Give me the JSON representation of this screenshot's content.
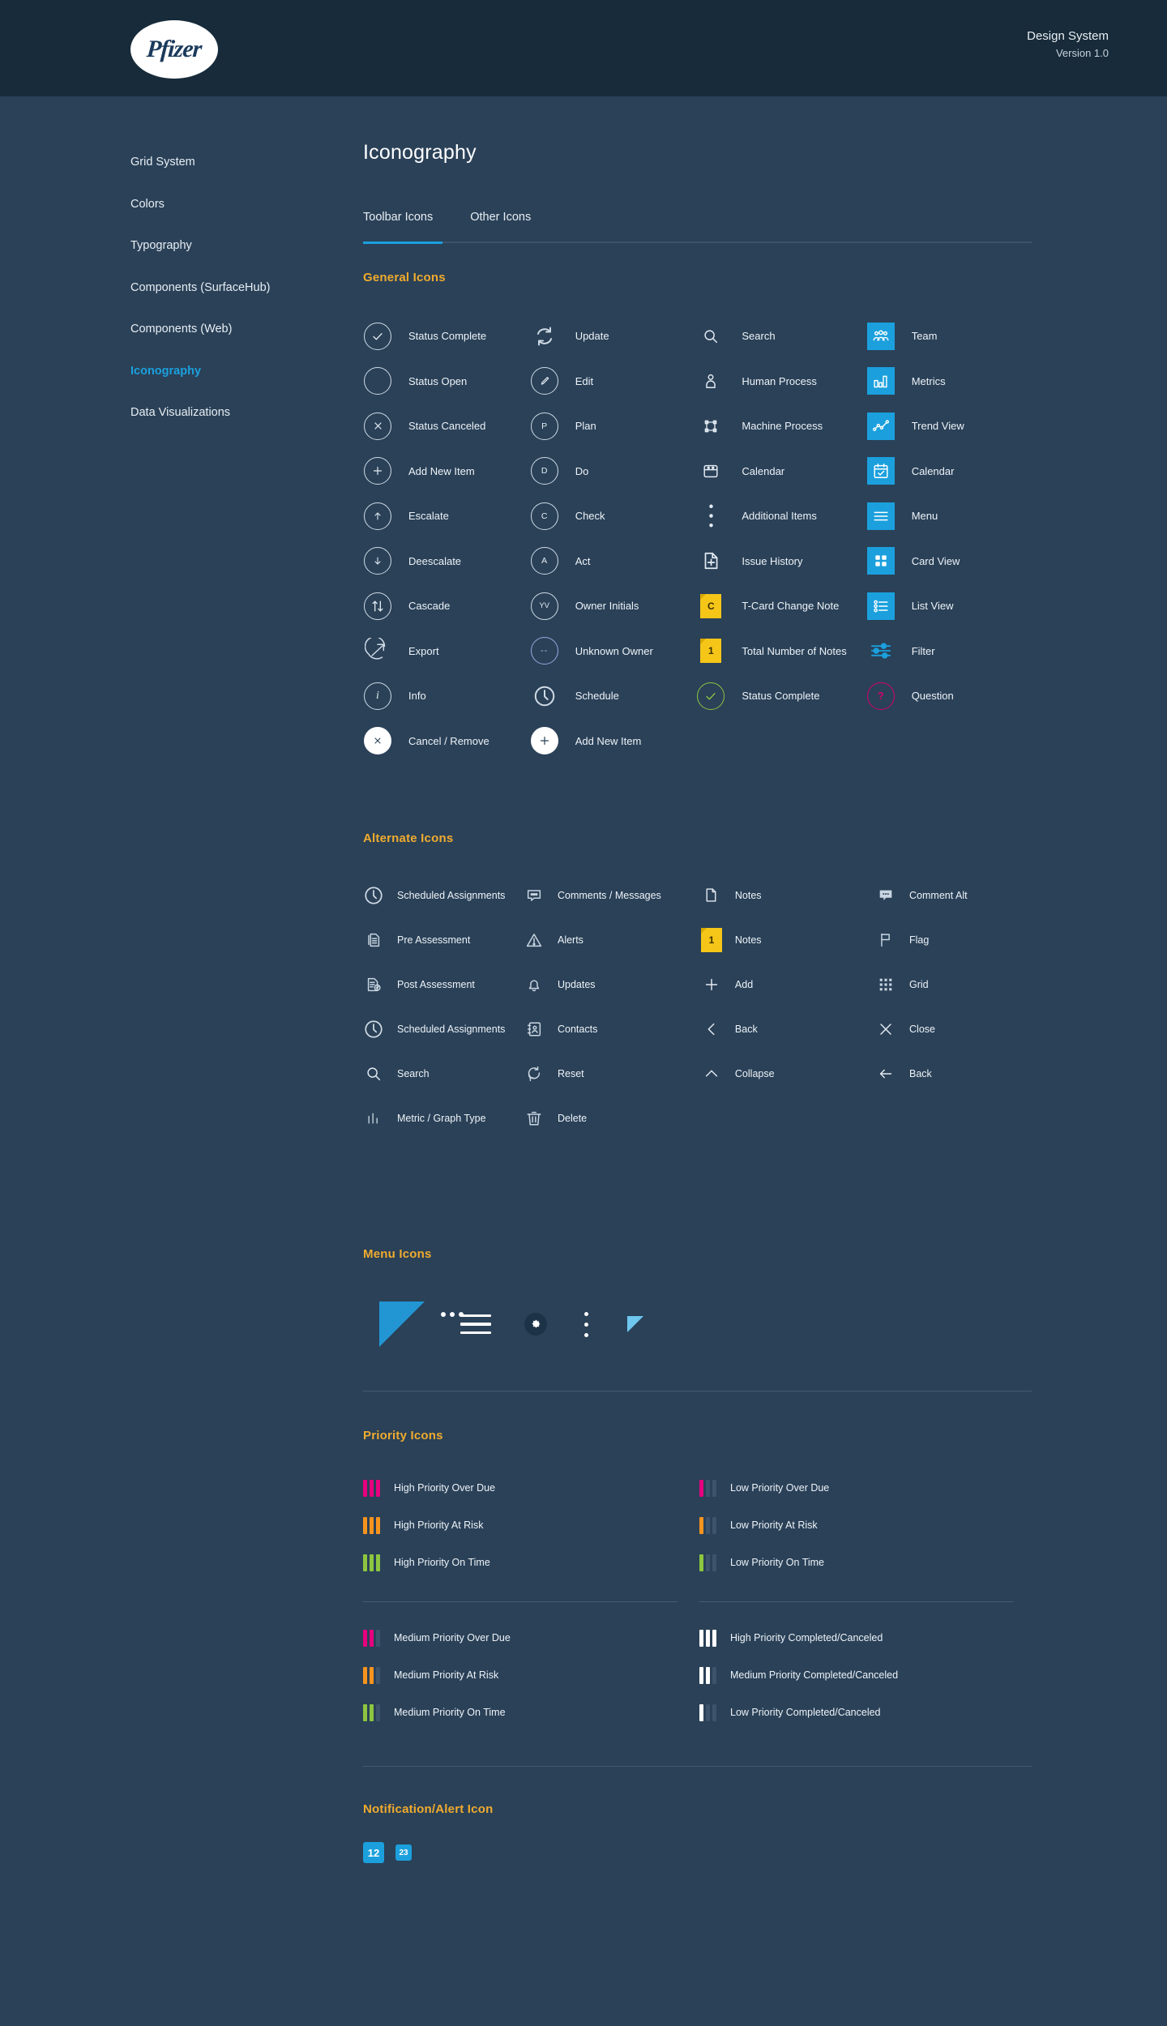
{
  "header": {
    "logo_text": "Pfizer",
    "title": "Design System",
    "version": "Version 1.0"
  },
  "sidebar": {
    "items": [
      {
        "label": "Grid System",
        "active": false
      },
      {
        "label": "Colors",
        "active": false
      },
      {
        "label": "Typography",
        "active": false
      },
      {
        "label": "Components (SurfaceHub)",
        "active": false
      },
      {
        "label": "Components (Web)",
        "active": false
      },
      {
        "label": "Iconography",
        "active": true
      },
      {
        "label": "Data Visualizations",
        "active": false
      }
    ]
  },
  "page": {
    "title": "Iconography",
    "tabs": [
      {
        "label": "Toolbar Icons",
        "active": true
      },
      {
        "label": "Other Icons",
        "active": false
      }
    ]
  },
  "sections": {
    "general": {
      "title": "General Icons",
      "col1": [
        {
          "label": "Status Complete",
          "icon": "circle-check-icon"
        },
        {
          "label": "Status Open",
          "icon": "circle-empty-icon"
        },
        {
          "label": "Status Canceled",
          "icon": "circle-x-icon"
        },
        {
          "label": "Add New Item",
          "icon": "circle-plus-icon"
        },
        {
          "label": "Escalate",
          "icon": "circle-arrow-up-icon"
        },
        {
          "label": "Deescalate",
          "icon": "circle-arrow-down-icon"
        },
        {
          "label": "Cascade",
          "icon": "circle-arrows-updown-icon"
        },
        {
          "label": "Export",
          "icon": "circle-export-arrow-icon"
        },
        {
          "label": "Info",
          "icon": "circle-info-icon"
        },
        {
          "label": "Cancel / Remove",
          "icon": "circle-x-solid-icon"
        }
      ],
      "col2": [
        {
          "label": "Update",
          "icon": "refresh-cycle-icon"
        },
        {
          "label": "Edit",
          "icon": "circle-pencil-icon"
        },
        {
          "label": "Plan",
          "icon": "circle-letter-p-icon",
          "letter": "P"
        },
        {
          "label": "Do",
          "icon": "circle-letter-d-icon",
          "letter": "D"
        },
        {
          "label": "Check",
          "icon": "circle-letter-c-icon",
          "letter": "C"
        },
        {
          "label": "Act",
          "icon": "circle-letter-a-icon",
          "letter": "A"
        },
        {
          "label": "Owner Initials",
          "icon": "circle-initials-icon",
          "letter": "YV"
        },
        {
          "label": "Unknown Owner",
          "icon": "circle-dashes-icon",
          "letter": "--"
        },
        {
          "label": "Schedule",
          "icon": "clock-icon"
        },
        {
          "label": "Add New Item",
          "icon": "circle-plus-solid-icon"
        }
      ],
      "col3": [
        {
          "label": "Search",
          "icon": "search-icon"
        },
        {
          "label": "Human Process",
          "icon": "person-icon"
        },
        {
          "label": "Machine Process",
          "icon": "machine-frame-icon"
        },
        {
          "label": "Calendar",
          "icon": "calendar-outline-icon"
        },
        {
          "label": "Additional Items",
          "icon": "vertical-dots-icon"
        },
        {
          "label": "Issue History",
          "icon": "document-plus-icon"
        },
        {
          "label": "T-Card Change Note",
          "icon": "yellow-note-c-icon",
          "letter": "C"
        },
        {
          "label": "Total Number of Notes",
          "icon": "yellow-note-1-icon",
          "letter": "1"
        },
        {
          "label": "Status Complete",
          "icon": "circle-check-green-icon"
        }
      ],
      "col4": [
        {
          "label": "Team",
          "icon": "team-icon"
        },
        {
          "label": "Metrics",
          "icon": "bar-chart-icon"
        },
        {
          "label": "Trend View",
          "icon": "trend-line-icon"
        },
        {
          "label": "Calendar",
          "icon": "calendar-check-icon"
        },
        {
          "label": "Menu",
          "icon": "hamburger-menu-icon"
        },
        {
          "label": "Card View",
          "icon": "card-grid-icon"
        },
        {
          "label": "List View",
          "icon": "list-view-icon"
        },
        {
          "label": "Filter",
          "icon": "filter-sliders-icon"
        },
        {
          "label": "Question",
          "icon": "circle-question-icon"
        }
      ]
    },
    "alternate": {
      "title": "Alternate Icons",
      "col1": [
        {
          "label": "Scheduled Assignments",
          "icon": "clock-icon"
        },
        {
          "label": "Pre Assessment",
          "icon": "document-lines-icon"
        },
        {
          "label": "Post Assessment",
          "icon": "document-check-icon"
        },
        {
          "label": "Scheduled Assignments",
          "icon": "clock-icon"
        },
        {
          "label": "Search",
          "icon": "search-icon"
        },
        {
          "label": "Metric / Graph Type",
          "icon": "bar-graph-icon"
        }
      ],
      "col2": [
        {
          "label": "Comments / Messages",
          "icon": "comment-dots-icon"
        },
        {
          "label": "Alerts",
          "icon": "warning-triangle-icon"
        },
        {
          "label": "Updates",
          "icon": "bell-icon"
        },
        {
          "label": "Contacts",
          "icon": "contacts-book-icon"
        },
        {
          "label": "Reset",
          "icon": "reset-circle-icon"
        },
        {
          "label": "Delete",
          "icon": "trash-icon"
        }
      ],
      "col3": [
        {
          "label": "Notes",
          "icon": "page-icon"
        },
        {
          "label": "Notes",
          "icon": "yellow-note-1-icon",
          "letter": "1"
        },
        {
          "label": "Add",
          "icon": "plus-icon"
        },
        {
          "label": "Back",
          "icon": "chevron-left-icon"
        },
        {
          "label": "Collapse",
          "icon": "chevron-up-icon"
        }
      ],
      "col4": [
        {
          "label": "Comment Alt",
          "icon": "comment-filled-icon"
        },
        {
          "label": "Flag",
          "icon": "flag-icon"
        },
        {
          "label": "Grid",
          "icon": "grid-dots-icon"
        },
        {
          "label": "Close",
          "icon": "close-x-icon"
        },
        {
          "label": "Back",
          "icon": "arrow-left-icon"
        }
      ]
    },
    "menu": {
      "title": "Menu Icons",
      "items": [
        {
          "icon": "triangle-dots-menu-icon"
        },
        {
          "icon": "hamburger-lines-icon"
        },
        {
          "icon": "gear-icon"
        },
        {
          "icon": "vertical-dots-icon"
        },
        {
          "icon": "small-triangle-icon"
        }
      ]
    },
    "priority": {
      "title": "Priority Icons",
      "left_top": [
        {
          "label": "High Priority Over Due",
          "bars": [
            "#e6007e",
            "#e6007e",
            "#e6007e"
          ]
        },
        {
          "label": "High Priority At Risk",
          "bars": [
            "#f7941e",
            "#f7941e",
            "#f7941e"
          ]
        },
        {
          "label": "High Priority On Time",
          "bars": [
            "#8dc63f",
            "#8dc63f",
            "#8dc63f"
          ]
        }
      ],
      "right_top": [
        {
          "label": "Low Priority Over Due",
          "bars": [
            "#e6007e",
            "#3c546b",
            "#3c546b"
          ]
        },
        {
          "label": "Low Priority At Risk",
          "bars": [
            "#f7941e",
            "#3c546b",
            "#3c546b"
          ]
        },
        {
          "label": "Low Priority On Time",
          "bars": [
            "#8dc63f",
            "#3c546b",
            "#3c546b"
          ]
        }
      ],
      "left_bottom": [
        {
          "label": "Medium Priority Over Due",
          "bars": [
            "#e6007e",
            "#e6007e",
            "#3c546b"
          ]
        },
        {
          "label": "Medium Priority At Risk",
          "bars": [
            "#f7941e",
            "#f7941e",
            "#3c546b"
          ]
        },
        {
          "label": "Medium Priority On Time",
          "bars": [
            "#8dc63f",
            "#8dc63f",
            "#3c546b"
          ]
        }
      ],
      "right_bottom": [
        {
          "label": "High Priority Completed/Canceled",
          "bars": [
            "#ffffff",
            "#ffffff",
            "#ffffff"
          ]
        },
        {
          "label": "Medium Priority Completed/Canceled",
          "bars": [
            "#ffffff",
            "#ffffff",
            "#3c546b"
          ]
        },
        {
          "label": "Low Priority Completed/Canceled",
          "bars": [
            "#ffffff",
            "#3c546b",
            "#3c546b"
          ]
        }
      ]
    },
    "notification": {
      "title": "Notification/Alert Icon",
      "badges": [
        "12",
        "23"
      ]
    }
  },
  "colors": {
    "header_bg": "#172b3a",
    "page_bg": "#2a4158",
    "accent_blue": "#1ba0dd",
    "accent_orange": "#f0ab2e",
    "yellow_note": "#f5c518",
    "green": "#8dc63f",
    "pink": "#d6006e"
  }
}
